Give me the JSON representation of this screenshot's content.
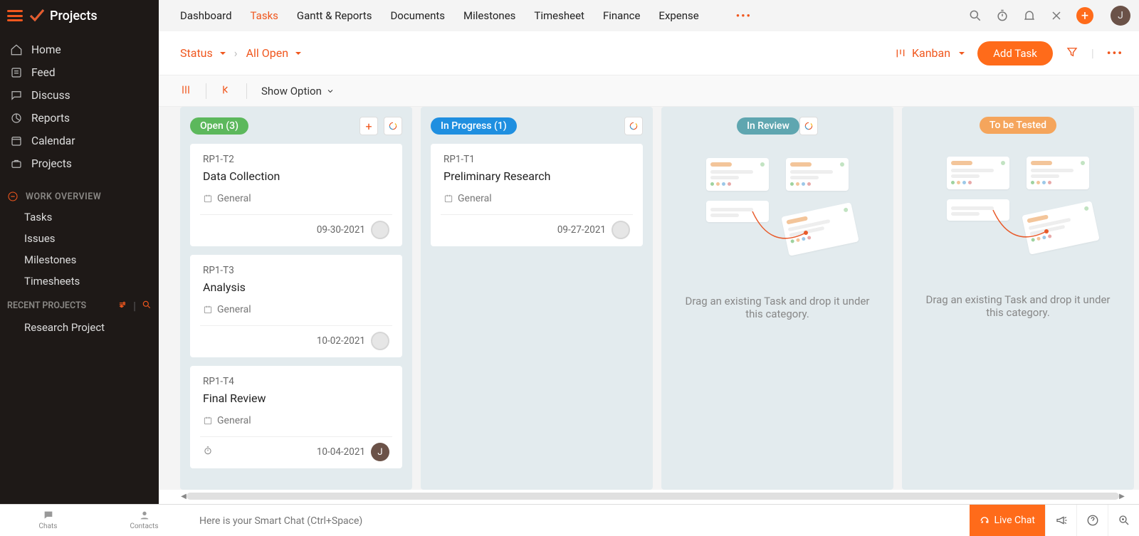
{
  "app_title": "Projects",
  "topnav": {
    "tabs": [
      "Dashboard",
      "Tasks",
      "Gantt & Reports",
      "Documents",
      "Milestones",
      "Timesheet",
      "Finance",
      "Expense"
    ],
    "active_index": 1,
    "avatar_initial": "J"
  },
  "sidebar": {
    "main": [
      {
        "icon": "home",
        "label": "Home"
      },
      {
        "icon": "feed",
        "label": "Feed"
      },
      {
        "icon": "discuss",
        "label": "Discuss"
      },
      {
        "icon": "reports",
        "label": "Reports"
      },
      {
        "icon": "calendar",
        "label": "Calendar"
      },
      {
        "icon": "projects",
        "label": "Projects"
      }
    ],
    "work_overview_label": "WORK OVERVIEW",
    "work_overview_items": [
      "Tasks",
      "Issues",
      "Milestones",
      "Timesheets"
    ],
    "recent_label": "RECENT PROJECTS",
    "recent_items": [
      "Research Project"
    ]
  },
  "subbar": {
    "status_label": "Status",
    "filter_label": "All Open",
    "view_label": "Kanban",
    "add_task_label": "Add Task"
  },
  "options": {
    "show_option_label": "Show Option"
  },
  "columns": [
    {
      "title": "Open (3)",
      "color": "green",
      "has_add": true,
      "cards": [
        {
          "id": "RP1-T2",
          "title": "Data Collection",
          "list": "General",
          "date": "09-30-2021",
          "avatar": "blank"
        },
        {
          "id": "RP1-T3",
          "title": "Analysis",
          "list": "General",
          "date": "10-02-2021",
          "avatar": "blank"
        },
        {
          "id": "RP1-T4",
          "title": "Final Review",
          "list": "General",
          "date": "10-04-2021",
          "avatar": "J",
          "has_timer": true
        }
      ]
    },
    {
      "title": "In Progress (1)",
      "color": "blue",
      "has_add": false,
      "cards": [
        {
          "id": "RP1-T1",
          "title": "Preliminary Research",
          "list": "General",
          "date": "09-27-2021",
          "avatar": "blank"
        }
      ]
    },
    {
      "title": "In Review",
      "color": "teal",
      "has_add": false,
      "empty": true,
      "empty_text": "Drag an existing Task and drop it under this category."
    },
    {
      "title": "To be Tested",
      "color": "orange",
      "has_add": false,
      "empty": true,
      "empty_text": "Drag an existing Task and drop it under this category."
    }
  ],
  "bottombar": {
    "chats_label": "Chats",
    "contacts_label": "Contacts",
    "smart_chat_placeholder": "Here is your Smart Chat (Ctrl+Space)",
    "live_chat_label": "Live Chat"
  }
}
